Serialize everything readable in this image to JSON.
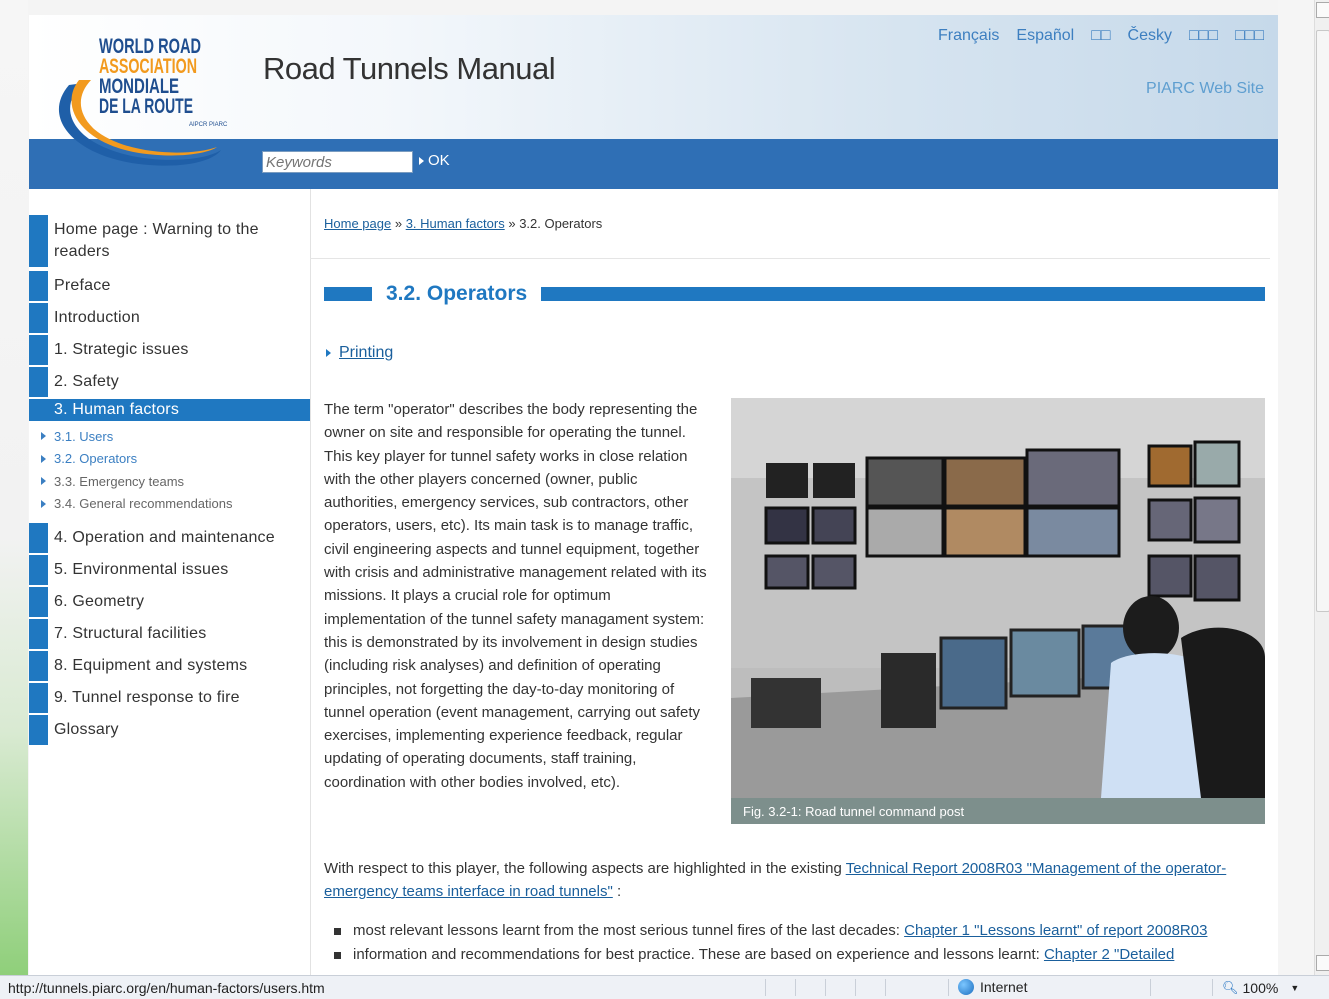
{
  "header": {
    "logo": {
      "lines": [
        "WORLD ROAD",
        "ASSOCIATION",
        "MONDIALE",
        "DE LA ROUTE"
      ],
      "small": "AIPCR PIARC"
    },
    "site_title": "Road Tunnels Manual",
    "languages": [
      "Français",
      "Español",
      "□□",
      "Česky",
      "□□□",
      "□□□"
    ],
    "piarc_link": "PIARC Web Site",
    "search_placeholder": "Keywords",
    "ok_label": "OK"
  },
  "sidebar": {
    "items": [
      {
        "label": "Home page : Warning to the readers"
      },
      {
        "label": "Preface"
      },
      {
        "label": "Introduction"
      },
      {
        "label": "1. Strategic issues"
      },
      {
        "label": "2. Safety"
      },
      {
        "label": "3. Human factors"
      },
      {
        "label": "4. Operation and maintenance"
      },
      {
        "label": "5. Environmental issues"
      },
      {
        "label": "6. Geometry"
      },
      {
        "label": "7. Structural facilities"
      },
      {
        "label": "8. Equipment and systems"
      },
      {
        "label": "9. Tunnel response to fire"
      },
      {
        "label": "Glossary"
      }
    ],
    "sub_items": [
      {
        "label": "3.1. Users"
      },
      {
        "label": "3.2. Operators"
      },
      {
        "label": "3.3. Emergency teams"
      },
      {
        "label": "3.4. General recommendations"
      }
    ]
  },
  "breadcrumb": {
    "home": "Home page",
    "sep": "»",
    "section": "3. Human factors",
    "current": "3.2. Operators"
  },
  "main": {
    "title": "3.2. Operators",
    "printing": "Printing",
    "para1": "The term \"operator\" describes the body representing the owner on site and responsible for operating the tunnel. This key player for tunnel safety works in close relation with the other players concerned (owner, public authorities, emergency services, sub contractors, other operators, users, etc). Its main task is to manage traffic, civil engineering aspects and tunnel equipment, together with crisis and administrative management related with its missions. It plays a crucial role for optimum implementation of the tunnel safety managament system: this is demonstrated by its involvement in design studies (including risk analyses) and definition of operating principles, not forgetting the day-to-day monitoring of tunnel operation (event management, carrying out safety exercises, implementing experience feedback, regular updating of operating documents, staff training, coordination with other bodies involved, etc).",
    "figure_caption": "Fig. 3.2-1: Road tunnel command post",
    "para2_text": "With respect to this player, the following aspects are highlighted in the existing ",
    "para2_link": "Technical Report 2008R03 \"Management of the operator-emergency teams interface in road tunnels\"",
    "para2_end": " :",
    "bullets": [
      {
        "text": "most relevant lessons learnt from the most serious tunnel fires of the last decades: ",
        "link": "Chapter 1 \"Lessons learnt\" of report 2008R03"
      },
      {
        "text": "information and recommendations for best practice. These are based on experience and lessons learnt: ",
        "link": "Chapter 2 \"Detailed"
      }
    ]
  },
  "statusbar": {
    "url": "http://tunnels.piarc.org/en/human-factors/users.htm",
    "zone": "Internet",
    "zoom": "100%"
  },
  "colors": {
    "brand_blue": "#1f78c1",
    "search_bar": "#2f6fb5",
    "link": "#1a5f9c"
  }
}
